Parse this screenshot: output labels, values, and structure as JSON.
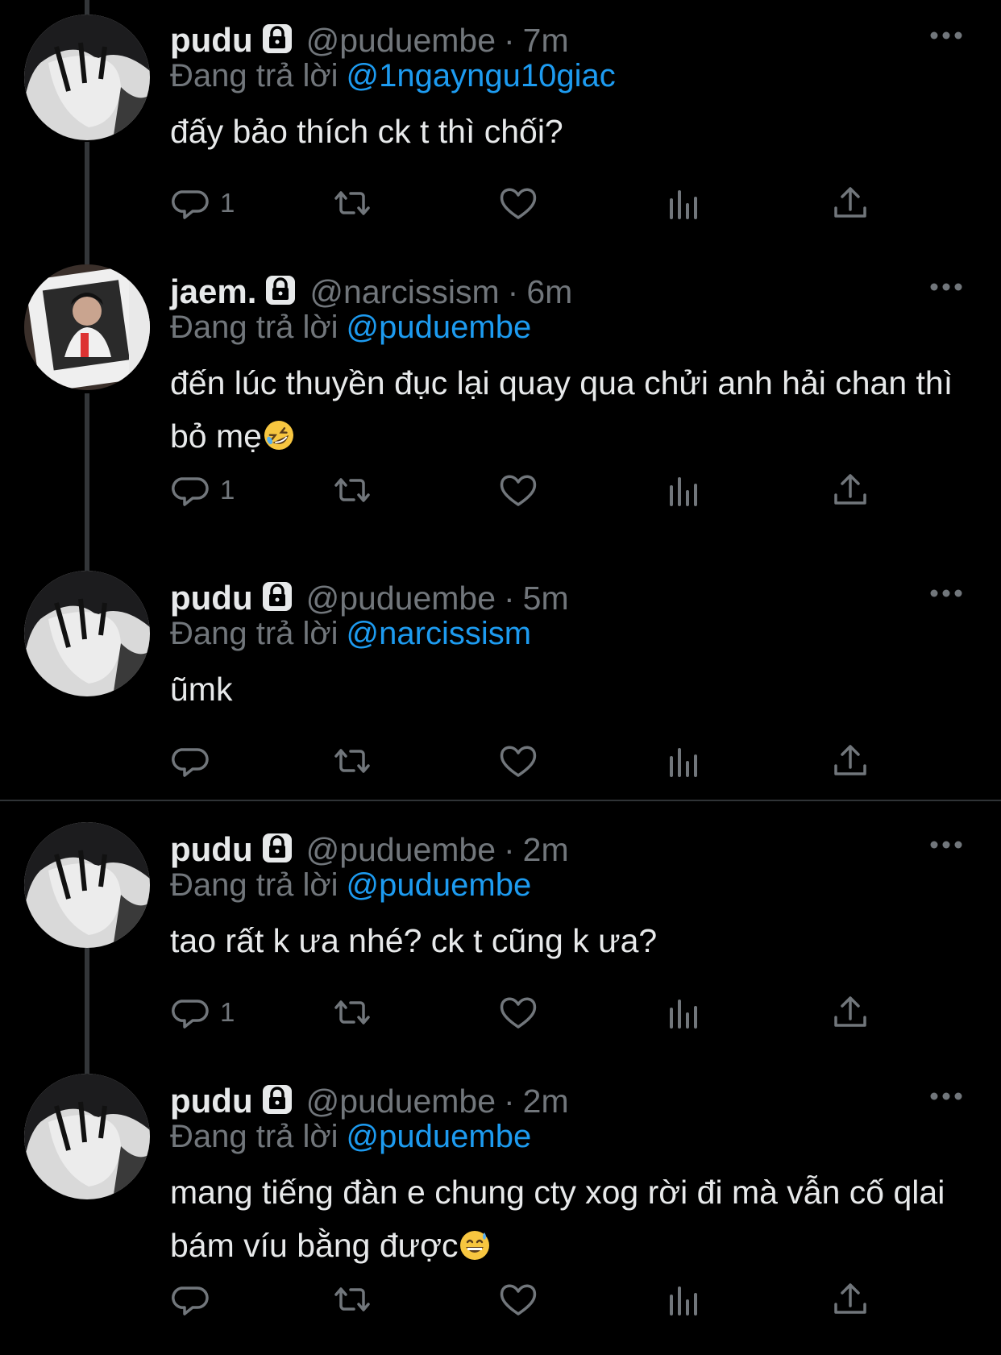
{
  "reply_prefix": "Đang trả lời",
  "tweets": [
    {
      "name": "pudu",
      "handle": "@puduembe",
      "separator": "·",
      "time": "7m",
      "reply_to": "@1ngayngu10giac",
      "text": "đấy bảo thích ck t thì chối?",
      "emoji": "",
      "reply_count": "1",
      "avatar": "pudu-avatar"
    },
    {
      "name": "jaem.",
      "handle": "@narcissism",
      "separator": "·",
      "time": "6m",
      "reply_to": "@puduembe",
      "text": "đến lúc thuyền đục lại quay qua chửi anh hải chan thì bỏ mẹ",
      "emoji": "rolling-on-floor-laughing",
      "reply_count": "1",
      "avatar": "jaem-avatar"
    },
    {
      "name": "pudu",
      "handle": "@puduembe",
      "separator": "·",
      "time": "5m",
      "reply_to": "@narcissism",
      "text": "ũmk",
      "emoji": "",
      "reply_count": "",
      "avatar": "pudu-avatar"
    },
    {
      "name": "pudu",
      "handle": "@puduembe",
      "separator": "·",
      "time": "2m",
      "reply_to": "@puduembe",
      "text": "tao rất k ưa nhé? ck t cũng k ưa?",
      "emoji": "",
      "reply_count": "1",
      "avatar": "pudu-avatar"
    },
    {
      "name": "pudu",
      "handle": "@puduembe",
      "separator": "·",
      "time": "2m",
      "reply_to": "@puduembe",
      "text": "mang tiếng đàn e chung cty xog rời đi mà vẫn cố qlai bám víu bằng được",
      "emoji": "grinning-sweat",
      "reply_count": "",
      "avatar": "pudu-avatar"
    }
  ],
  "colors": {
    "background": "#000000",
    "text": "#e7e9ea",
    "secondary": "#71767b",
    "mention": "#1d9bf0",
    "thread_line": "#333639"
  }
}
